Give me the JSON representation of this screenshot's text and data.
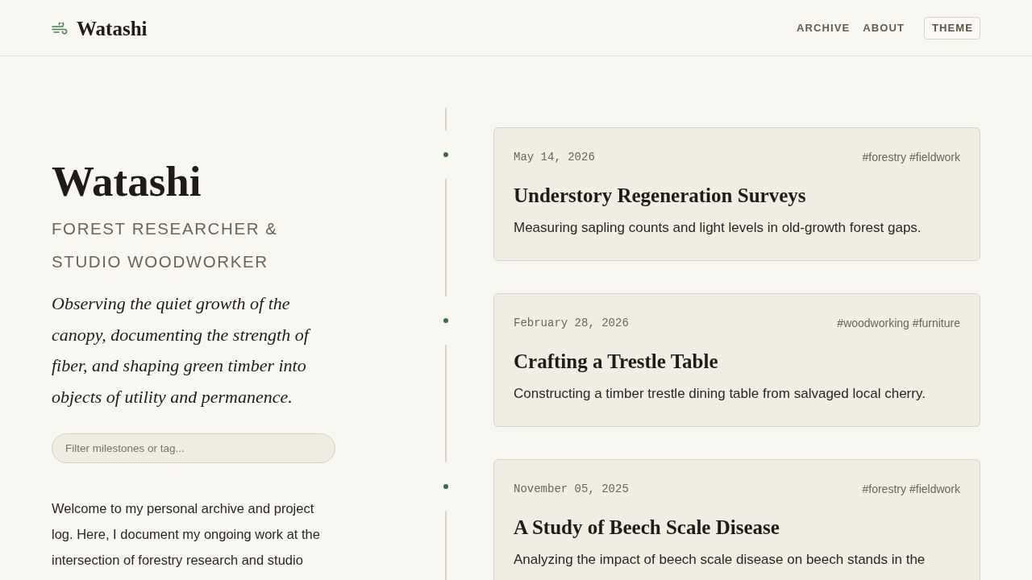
{
  "header": {
    "brand": "Watashi",
    "nav": [
      {
        "label": "ARCHIVE"
      },
      {
        "label": "ABOUT"
      }
    ],
    "theme_button": "THEME"
  },
  "profile": {
    "name": "Watashi",
    "subtitle": "FOREST RESEARCHER & STUDIO WOODWORKER",
    "tagline": "Observing the quiet growth of the canopy, documenting the strength of fiber, and shaping green timber into objects of utility and permanence.",
    "filter": {
      "placeholder": "Filter milestones or tag..."
    },
    "intro": "Welcome to my personal archive and project log. Here, I document my ongoing work at the intersection of forestry research and studio"
  },
  "timeline": [
    {
      "date": "May 14, 2026",
      "tags": [
        "#forestry",
        "#fieldwork"
      ],
      "title": "Understory Regeneration Surveys",
      "description": "Measuring sapling counts and light levels in old-growth forest gaps."
    },
    {
      "date": "February 28, 2026",
      "tags": [
        "#woodworking",
        "#furniture"
      ],
      "title": "Crafting a Trestle Table",
      "description": "Constructing a timber trestle dining table from salvaged local cherry."
    },
    {
      "date": "November 05, 2025",
      "tags": [
        "#forestry",
        "#fieldwork"
      ],
      "title": "A Study of Beech Scale Disease",
      "description": "Analyzing the impact of beech scale disease on beech stands in the"
    }
  ]
}
